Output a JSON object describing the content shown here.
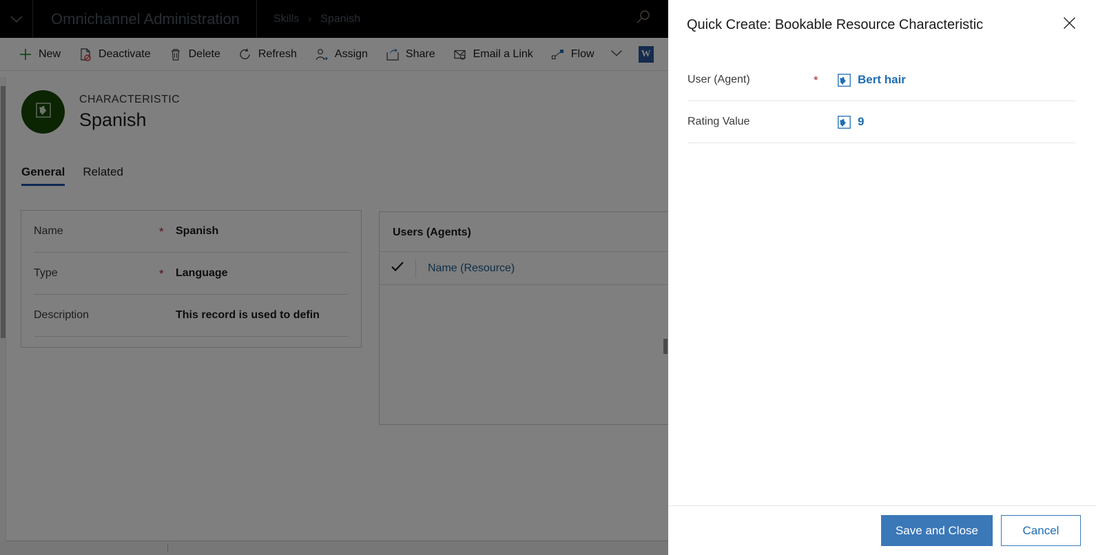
{
  "app": {
    "title": "Omnichannel Administration",
    "breadcrumb": {
      "parent": "Skills",
      "separator": "›",
      "current": "Spanish"
    },
    "nav_icon": "chevron-down-icon",
    "search_icon": "search-icon"
  },
  "commandbar": {
    "items": [
      {
        "label": "New",
        "icon": "plus-icon"
      },
      {
        "label": "Deactivate",
        "icon": "deactivate-page-icon"
      },
      {
        "label": "Delete",
        "icon": "trash-icon"
      },
      {
        "label": "Refresh",
        "icon": "refresh-icon"
      },
      {
        "label": "Assign",
        "icon": "assign-person-icon"
      },
      {
        "label": "Share",
        "icon": "share-icon"
      },
      {
        "label": "Email a Link",
        "icon": "email-link-icon"
      },
      {
        "label": "Flow",
        "icon": "flow-icon"
      }
    ],
    "overflow_icon": "chevron-down-icon",
    "word_icon": "word-icon",
    "word_glyph": "W"
  },
  "record": {
    "entity_type": "CHARACTERISTIC",
    "name": "Spanish",
    "avatar_icon": "characteristic-puzzle-icon",
    "avatar_color": "#164905"
  },
  "tabs": [
    {
      "label": "General",
      "active": true
    },
    {
      "label": "Related",
      "active": false
    }
  ],
  "form": {
    "fields": [
      {
        "label": "Name",
        "required": "*",
        "value": "Spanish"
      },
      {
        "label": "Type",
        "required": "*",
        "value": "Language"
      },
      {
        "label": "Description",
        "required": "",
        "value": "This record is used to defin"
      }
    ]
  },
  "subgrid": {
    "title": "Users (Agents)",
    "select_all_icon": "checkmark-icon",
    "columns": [
      "Name (Resource)"
    ]
  },
  "quick_create": {
    "title": "Quick Create: Bookable Resource Characteristic",
    "close_icon": "close-icon",
    "fields": [
      {
        "label": "User (Agent)",
        "required": "*",
        "icon": "lookup-puzzle-icon",
        "value": "Bert hair"
      },
      {
        "label": "Rating Value",
        "required": "",
        "icon": "lookup-puzzle-icon",
        "value": "9"
      }
    ],
    "buttons": {
      "save_label": "Save and Close",
      "cancel_label": "Cancel"
    }
  },
  "colors": {
    "accent_blue": "#3b78b8",
    "link_blue": "#1f6db3",
    "required_red": "#a4262c",
    "tab_underline": "#1f51a8",
    "avatar_green": "#164905",
    "topbar_black": "#000000"
  }
}
